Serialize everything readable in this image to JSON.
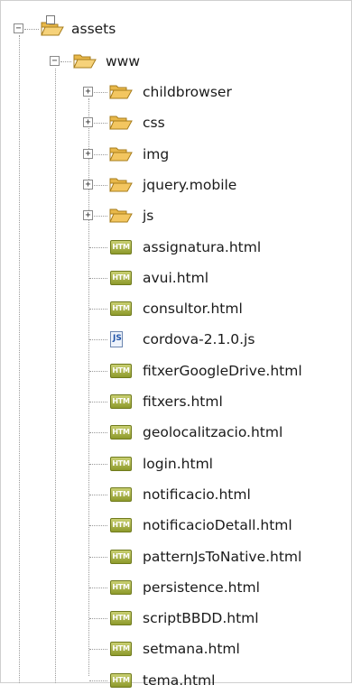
{
  "tree": {
    "root": {
      "label": "assets",
      "expanded": true,
      "icon": "folder-open-icon"
    },
    "www": {
      "label": "www",
      "expanded": true,
      "icon": "folder-open-icon"
    },
    "folders": [
      {
        "label": "childbrowser",
        "expanded": false,
        "icon": "folder-icon"
      },
      {
        "label": "css",
        "expanded": false,
        "icon": "folder-icon"
      },
      {
        "label": "img",
        "expanded": false,
        "icon": "folder-icon"
      },
      {
        "label": "jquery.mobile",
        "expanded": false,
        "icon": "folder-icon"
      },
      {
        "label": "js",
        "expanded": false,
        "icon": "folder-icon"
      }
    ],
    "files": [
      {
        "label": "assignatura.html",
        "type": "htm"
      },
      {
        "label": "avui.html",
        "type": "htm"
      },
      {
        "label": "consultor.html",
        "type": "htm"
      },
      {
        "label": "cordova-2.1.0.js",
        "type": "js"
      },
      {
        "label": "fitxerGoogleDrive.html",
        "type": "htm"
      },
      {
        "label": "fitxers.html",
        "type": "htm"
      },
      {
        "label": "geolocalitzacio.html",
        "type": "htm"
      },
      {
        "label": "login.html",
        "type": "htm"
      },
      {
        "label": "notificacio.html",
        "type": "htm"
      },
      {
        "label": "notificacioDetall.html",
        "type": "htm"
      },
      {
        "label": "patternJsToNative.html",
        "type": "htm"
      },
      {
        "label": "persistence.html",
        "type": "htm"
      },
      {
        "label": "scriptBBDD.html",
        "type": "htm"
      },
      {
        "label": "setmana.html",
        "type": "htm"
      },
      {
        "label": "tema.html",
        "type": "htm"
      }
    ],
    "htm_badge": "HTM",
    "js_badge": "JS",
    "expand_glyph": "+",
    "collapse_glyph": "−"
  },
  "colors": {
    "folder": "#e8b84a",
    "htm_badge": "#a3ad3a",
    "tree_lines": "#9a9a9a"
  }
}
